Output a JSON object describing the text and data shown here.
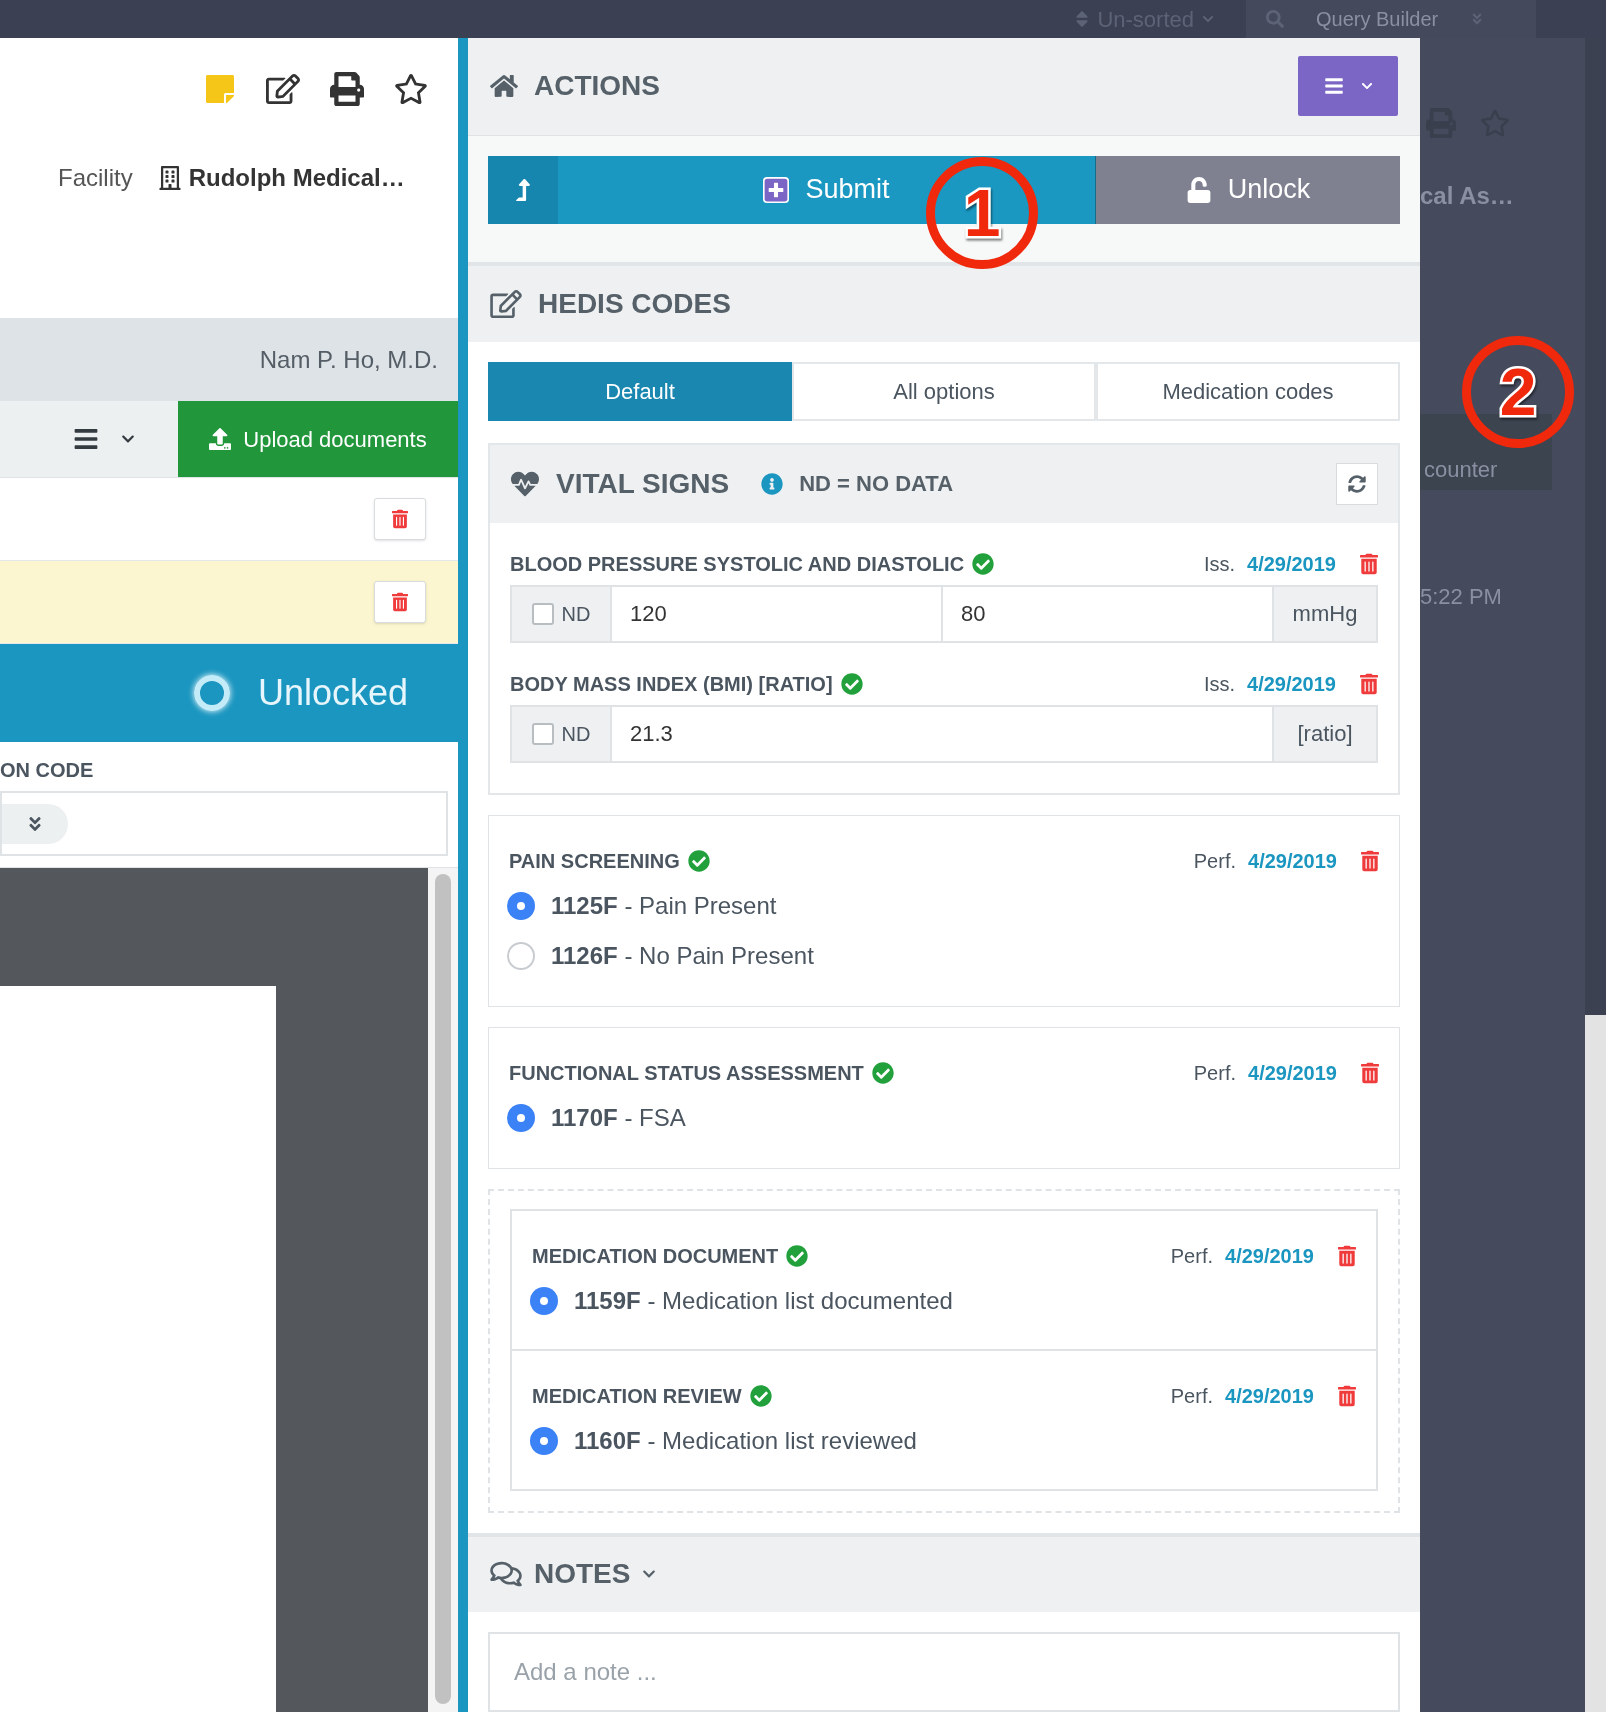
{
  "top_bar": {
    "sort": "Un-sorted",
    "query_builder": "Query Builder"
  },
  "left_panel": {
    "facility_label": "Facility",
    "facility": "Rudolph Medical…",
    "provider": "Nam P. Ho, M.D.",
    "upload_button": "Upload documents",
    "rows": [
      {
        "highlighted": false
      },
      {
        "highlighted": true
      }
    ],
    "status": "Unlocked",
    "field_label": "ON CODE"
  },
  "background_panel": {
    "title": "cal As…",
    "button": "counter",
    "time": "5:22 PM"
  },
  "actions": {
    "title": "ACTIONS",
    "buttons": [
      {
        "label": "Submit",
        "kind": "primary"
      },
      {
        "label": "Unlock",
        "kind": "secondary"
      }
    ]
  },
  "hedis": {
    "title": "HEDIS CODES",
    "tabs": [
      {
        "label": "Default",
        "selected": true
      },
      {
        "label": "All options",
        "selected": false
      },
      {
        "label": "Medication codes",
        "selected": false
      }
    ],
    "vital_signs": {
      "title": "VITAL SIGNS",
      "note": "ND = NO DATA",
      "measures": [
        {
          "label": "BLOOD PRESSURE SYSTOLIC AND DIASTOLIC",
          "complete": true,
          "date_prefix": "Iss.",
          "date": "4/29/2019",
          "nd_label": "ND",
          "nd_checked": false,
          "values": [
            "120",
            "80"
          ],
          "unit": "mmHg"
        },
        {
          "label": "BODY MASS INDEX (BMI) [RATIO]",
          "complete": true,
          "date_prefix": "Iss.",
          "date": "4/29/2019",
          "nd_label": "ND",
          "nd_checked": false,
          "values": [
            "21.3"
          ],
          "unit": "[ratio]"
        }
      ]
    },
    "sections": [
      {
        "label": "PAIN SCREENING",
        "complete": true,
        "date_prefix": "Perf.",
        "date": "4/29/2019",
        "options": [
          {
            "text": "**1125F** - Pain Present",
            "selected": true
          },
          {
            "text": "**1126F** - No Pain Present",
            "selected": false
          }
        ]
      },
      {
        "label": "FUNCTIONAL STATUS ASSESSMENT",
        "complete": true,
        "date_prefix": "Perf.",
        "date": "4/29/2019",
        "options": [
          {
            "text": "**1170F** - FSA",
            "selected": true
          }
        ]
      }
    ],
    "grouped_sections": [
      {
        "label": "MEDICATION DOCUMENT",
        "complete": true,
        "date_prefix": "Perf.",
        "date": "4/29/2019",
        "options": [
          {
            "text": "**1159F** - Medication list documented",
            "selected": true
          }
        ]
      },
      {
        "label": "MEDICATION REVIEW",
        "complete": true,
        "date_prefix": "Perf.",
        "date": "4/29/2019",
        "options": [
          {
            "text": "**1160F** - Medication list reviewed",
            "selected": true
          }
        ]
      }
    ]
  },
  "notes": {
    "title": "NOTES",
    "placeholder": "Add a note ..."
  },
  "annotations": [
    "1",
    "2"
  ]
}
